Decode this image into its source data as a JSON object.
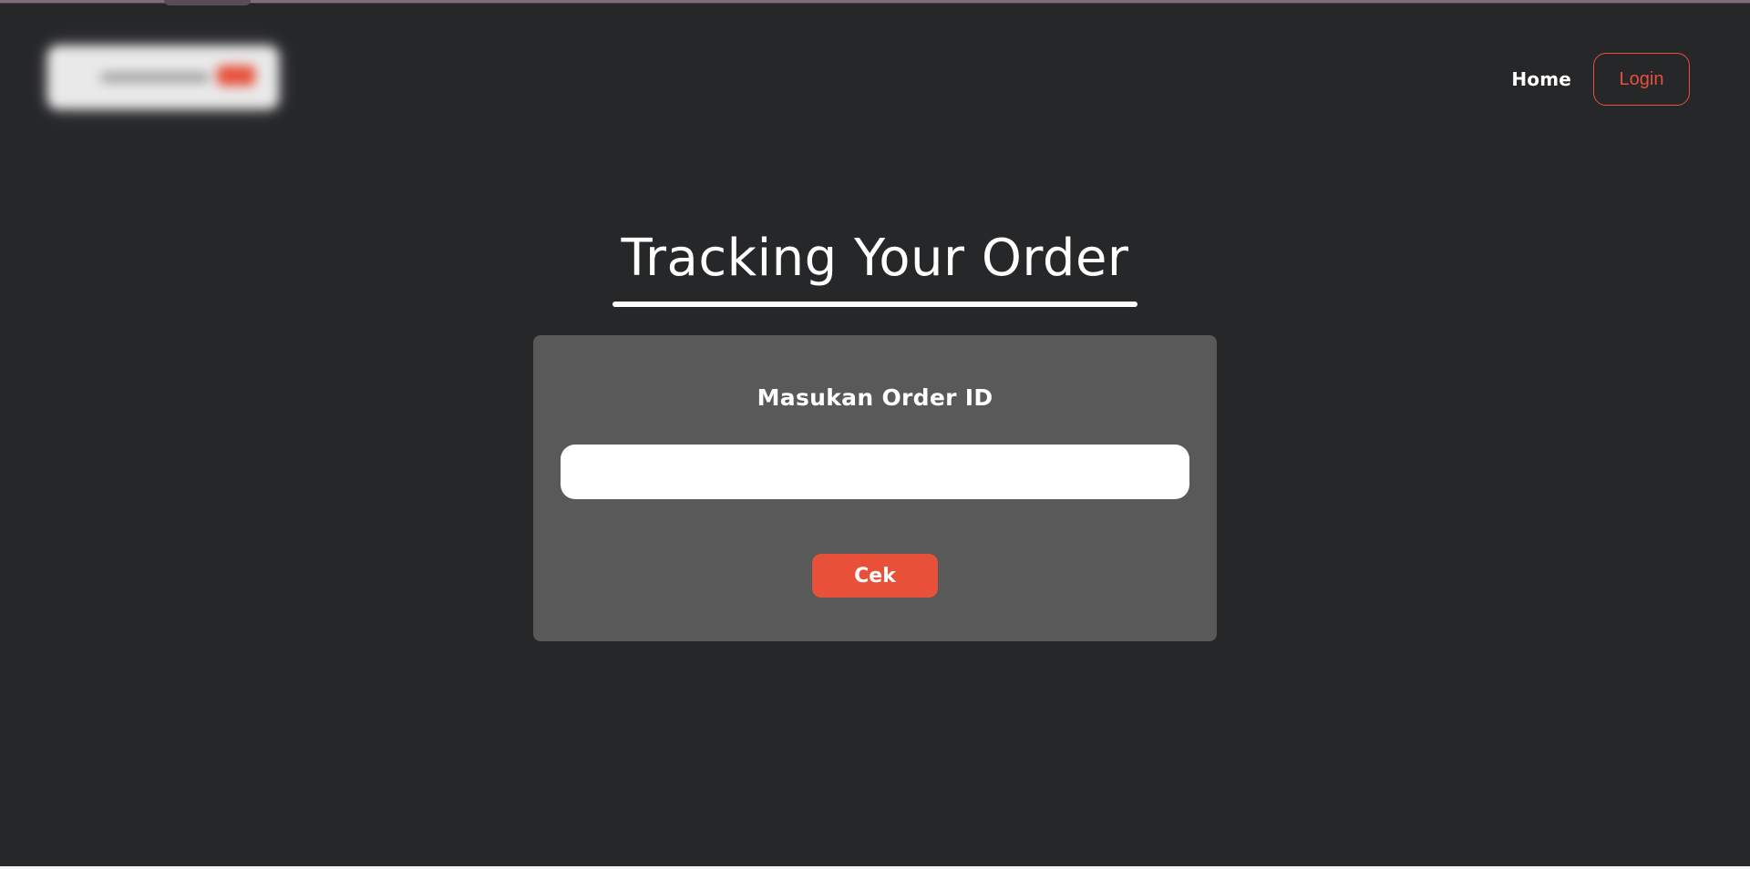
{
  "nav": {
    "home_label": "Home",
    "login_label": "Login"
  },
  "main": {
    "title": "Tracking Your Order",
    "form": {
      "label": "Masukan Order ID",
      "input_value": "",
      "input_placeholder": "",
      "submit_label": "Cek"
    }
  },
  "colors": {
    "background": "#262729",
    "card": "#595959",
    "accent": "#e8503a",
    "text": "#ffffff"
  }
}
